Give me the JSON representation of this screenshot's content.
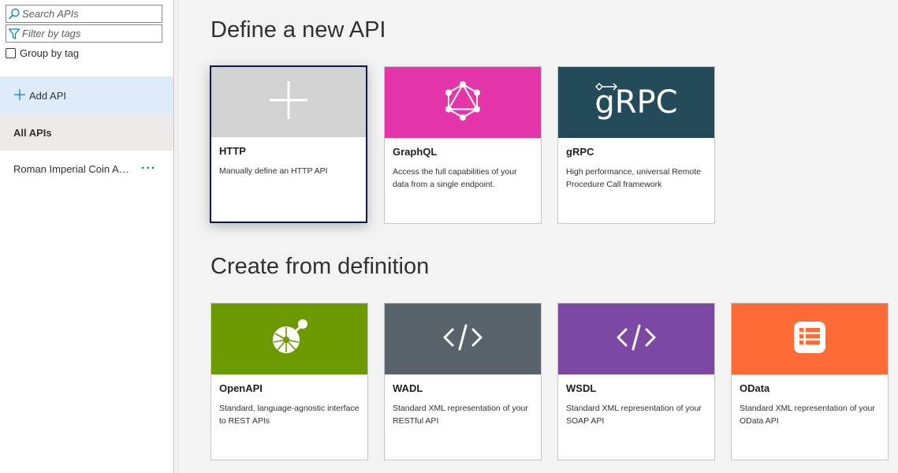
{
  "sidebar": {
    "search_placeholder": "Search APIs",
    "filter_placeholder": "Filter by tags",
    "group_by_tag_label": "Group by tag",
    "add_api_label": "Add API",
    "all_apis_label": "All APIs",
    "api_items": [
      {
        "label": "Roman Imperial Coin An...",
        "more_icon": "ellipsis-icon"
      }
    ]
  },
  "main": {
    "define_title": "Define a new API",
    "create_title": "Create from definition",
    "define_cards": [
      {
        "title": "HTTP",
        "description": "Manually define an HTTP API",
        "color": "#d2d2d2",
        "icon": "plus-icon"
      },
      {
        "title": "GraphQL",
        "description": "Access the full capabilities of your data from a single endpoint.",
        "color": "#e535ab",
        "icon": "graphql-icon"
      },
      {
        "title": "gRPC",
        "description": "High performance, universal Remote Procedure Call framework",
        "color": "#244b5a",
        "icon": "grpc-logo",
        "logo_text": "gRPC"
      }
    ],
    "create_cards": [
      {
        "title": "OpenAPI",
        "description": "Standard, language-agnostic interface to REST APIs",
        "color": "#6b9a00",
        "icon": "openapi-icon"
      },
      {
        "title": "WADL",
        "description": "Standard XML representation of your RESTful API",
        "color": "#58636b",
        "icon": "code-icon"
      },
      {
        "title": "WSDL",
        "description": "Standard XML representation of your SOAP API",
        "color": "#7b48a4",
        "icon": "code-icon"
      },
      {
        "title": "OData",
        "description": "Standard XML representation of your OData API",
        "color": "#fe6b37",
        "icon": "odata-icon"
      }
    ]
  }
}
